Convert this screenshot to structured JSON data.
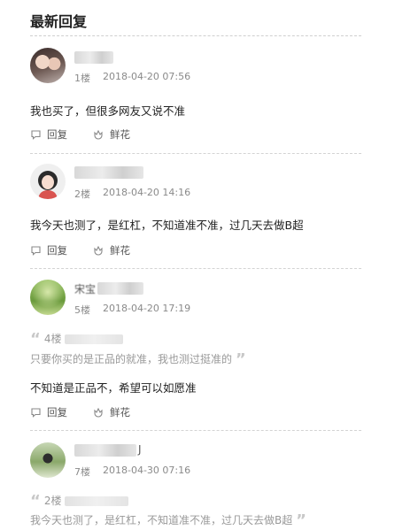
{
  "header": {
    "title": "最新回复"
  },
  "actions": {
    "reply_label": "回复",
    "flower_label": "鲜花"
  },
  "replies": [
    {
      "floor": "1楼",
      "date": "2018-04-20 07:56",
      "content": "我也买了，但很多网友又说不准"
    },
    {
      "floor": "2楼",
      "date": "2018-04-20 14:16",
      "content": "我今天也测了，是红杠，不知道准不准，过几天去做B超"
    },
    {
      "floor": "5楼",
      "date": "2018-04-20 17:19",
      "username_partial": "宋宝",
      "quote": {
        "floor": "4楼",
        "text": "只要你买的是正品的就准，我也测过挺准的"
      },
      "content": "不知道是正品不，希望可以如愿准"
    },
    {
      "floor": "7楼",
      "date": "2018-04-30 07:16",
      "username_partial": "J",
      "quote": {
        "floor": "2楼",
        "text": "我今天也测了，是红杠，不知道准不准，过几天去做B超"
      }
    }
  ]
}
